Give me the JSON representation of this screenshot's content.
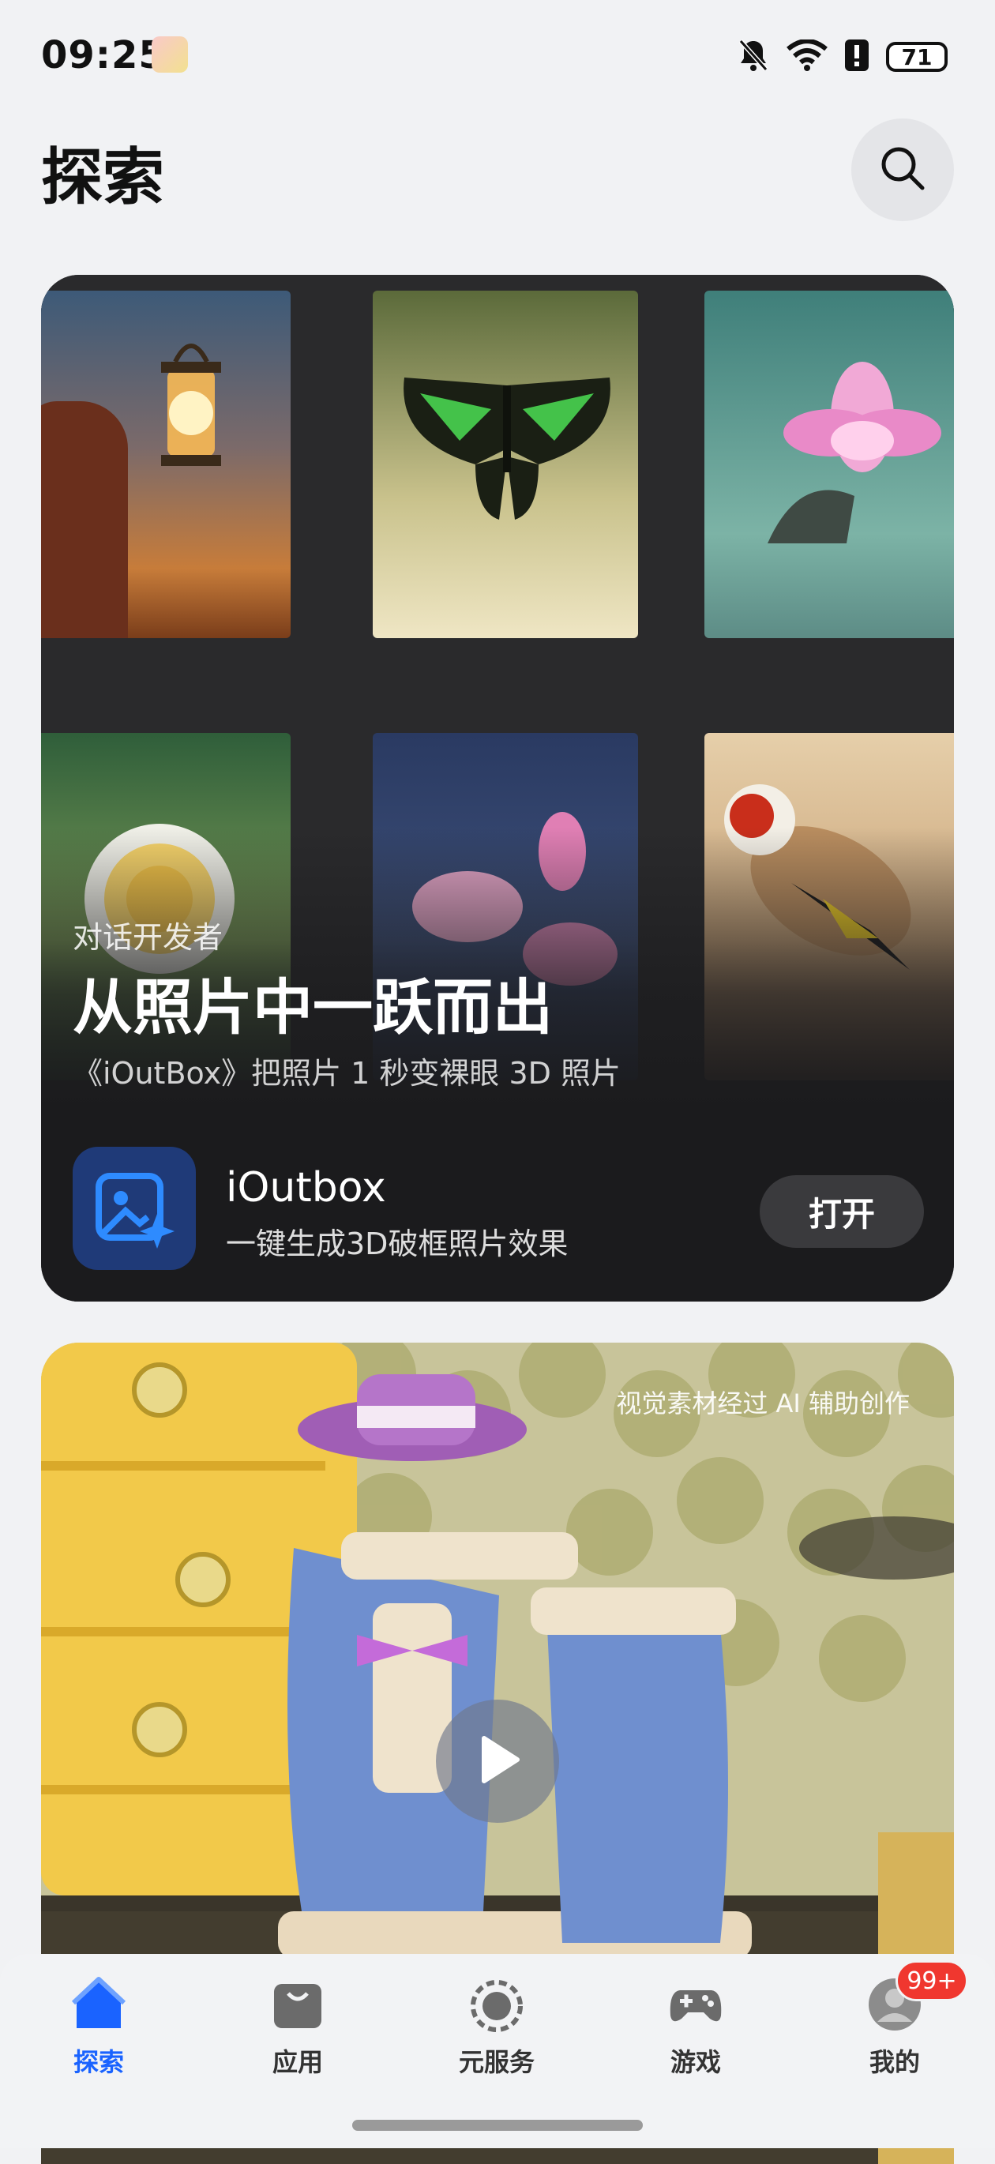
{
  "status_bar": {
    "time": "09:25",
    "battery": "71"
  },
  "header": {
    "title": "探索"
  },
  "feature_card": {
    "eyebrow": "对话开发者",
    "headline": "从照片中一跃而出",
    "subline": "《iOutBox》把照片 1 秒变裸眼 3D 照片",
    "app": {
      "name": "iOutbox",
      "description": "一键生成3D破框照片效果",
      "open_label": "打开"
    }
  },
  "video_card": {
    "ai_note": "视觉素材经过 AI 辅助创作"
  },
  "tab_bar": {
    "tabs": [
      {
        "label": "探索",
        "icon": "explore-icon",
        "active": true
      },
      {
        "label": "应用",
        "icon": "apps-icon",
        "active": false
      },
      {
        "label": "元服务",
        "icon": "atomic-services-icon",
        "active": false
      },
      {
        "label": "游戏",
        "icon": "gamepad-icon",
        "active": false
      },
      {
        "label": "我的",
        "icon": "profile-icon",
        "active": false
      }
    ],
    "badge": "99+"
  },
  "colors": {
    "accent": "#1a63ff",
    "badge": "#f0372f",
    "card_dark": "#1b1b1d"
  }
}
